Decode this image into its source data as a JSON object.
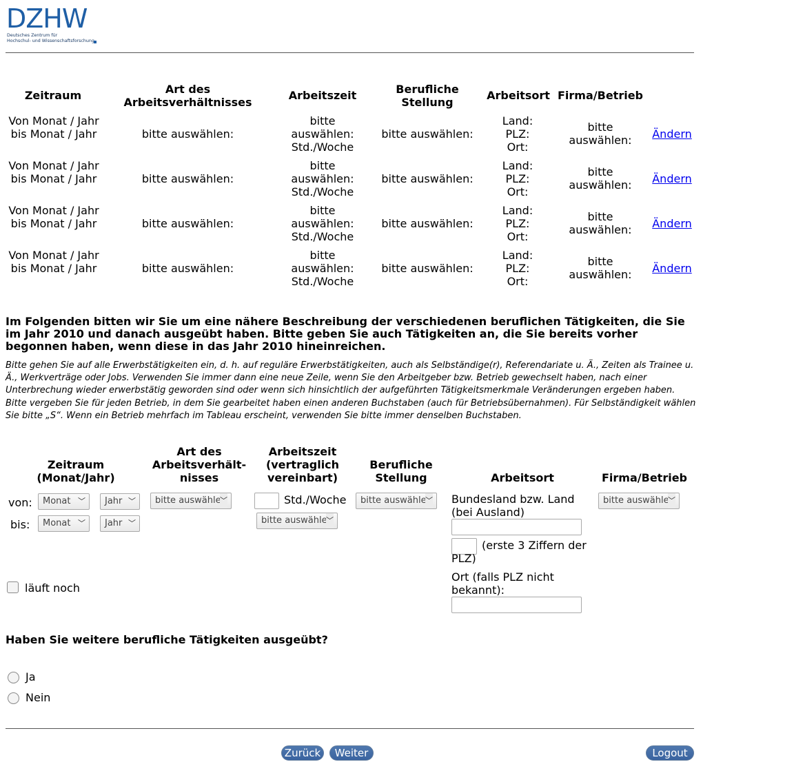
{
  "logo": {
    "wordmark": "DZHW",
    "subtitle_line1": "Deutsches Zentrum für",
    "subtitle_line2": "Hochschul- und Wissenschaftsforschung"
  },
  "summary_table": {
    "headers": [
      "Zeitraum",
      "Art des Arbeitsverhältnisses",
      "Arbeitszeit",
      "Berufliche Stellung",
      "Arbeitsort",
      "Firma/Betrieb"
    ],
    "rows": [
      {
        "zeitraum": "Von Monat / Jahr bis Monat / Jahr",
        "art": "bitte auswählen:",
        "arbeitszeit": "bitte auswählen: Std./Woche",
        "stellung": "bitte auswählen:",
        "ort": "Land: PLZ: Ort:",
        "firma": "bitte auswählen:",
        "action": "Ändern"
      },
      {
        "zeitraum": "Von Monat / Jahr bis Monat / Jahr",
        "art": "bitte auswählen:",
        "arbeitszeit": "bitte auswählen: Std./Woche",
        "stellung": "bitte auswählen:",
        "ort": "Land: PLZ: Ort:",
        "firma": "bitte auswählen:",
        "action": "Ändern"
      },
      {
        "zeitraum": "Von Monat / Jahr bis Monat / Jahr",
        "art": "bitte auswählen:",
        "arbeitszeit": "bitte auswählen: Std./Woche",
        "stellung": "bitte auswählen:",
        "ort": "Land: PLZ: Ort:",
        "firma": "bitte auswählen:",
        "action": "Ändern"
      },
      {
        "zeitraum": "Von Monat / Jahr bis Monat / Jahr",
        "art": "bitte auswählen:",
        "arbeitszeit": "bitte auswählen: Std./Woche",
        "stellung": "bitte auswählen:",
        "ort": "Land: PLZ: Ort:",
        "firma": "bitte auswählen:",
        "action": "Ändern"
      }
    ]
  },
  "intro": {
    "heading": "Im Folgenden bitten wir Sie um eine nähere Beschreibung der verschiedenen beruflichen Tätigkeiten, die Sie im Jahr 2010 und danach ausgeübt haben. Bitte geben Sie auch Tätigkeiten an, die Sie bereits vorher begonnen haben, wenn diese in das Jahr 2010 hineinreichen.",
    "note1": "Bitte gehen Sie auf alle Erwerbstätigkeiten ein, d. h. auf reguläre Erwerbstätigkeiten, auch als Selbständige(r), Referendariate u. Ä., Zeiten als Trainee u. Ä., Werkverträge oder Jobs. Verwenden Sie immer dann eine neue Zeile, wenn Sie den Arbeitgeber bzw. Betrieb gewechselt haben, nach einer Unterbrechung wieder erwerbstätig geworden sind oder wenn sich hinsichtlich der aufgeführten Tätigkeitsmerkmale Veränderungen ergeben haben.",
    "note2": "Bitte vergeben Sie für jeden Betrieb, in dem Sie gearbeitet haben einen anderen Buchstaben (auch für Betriebsübernahmen). Für Selbständigkeit wählen Sie bitte „S“. Wenn ein Betrieb mehrfach im Tableau erscheint, verwenden Sie bitte immer denselben Buchstaben."
  },
  "form": {
    "headers": {
      "zeitraum": "Zeitraum (Monat/Jahr)",
      "art": "Art des Arbeitsverhält-nisses",
      "arbeitszeit": "Arbeitszeit (vertraglich vereinbart)",
      "stellung": "Berufliche Stellung",
      "arbeitsort": "Arbeitsort",
      "firma": "Firma/Betrieb"
    },
    "von_label": "von:",
    "bis_label": "bis:",
    "monat": "Monat",
    "jahr": "Jahr",
    "select_default": "bitte auswählen",
    "std_woche": "Std./Woche",
    "bundesland_label": "Bundesland bzw. Land (bei Ausland)",
    "plz_label": "(erste 3 Ziffern der PLZ)",
    "ort_label": "Ort (falls PLZ nicht bekannt):",
    "laeuft_noch": "läuft noch"
  },
  "question": {
    "text": "Haben Sie weitere berufliche Tätigkeiten ausgeübt?",
    "options": [
      "Ja",
      "Nein"
    ]
  },
  "buttons": {
    "back": "Zurück",
    "next": "Weiter",
    "logout": "Logout"
  }
}
